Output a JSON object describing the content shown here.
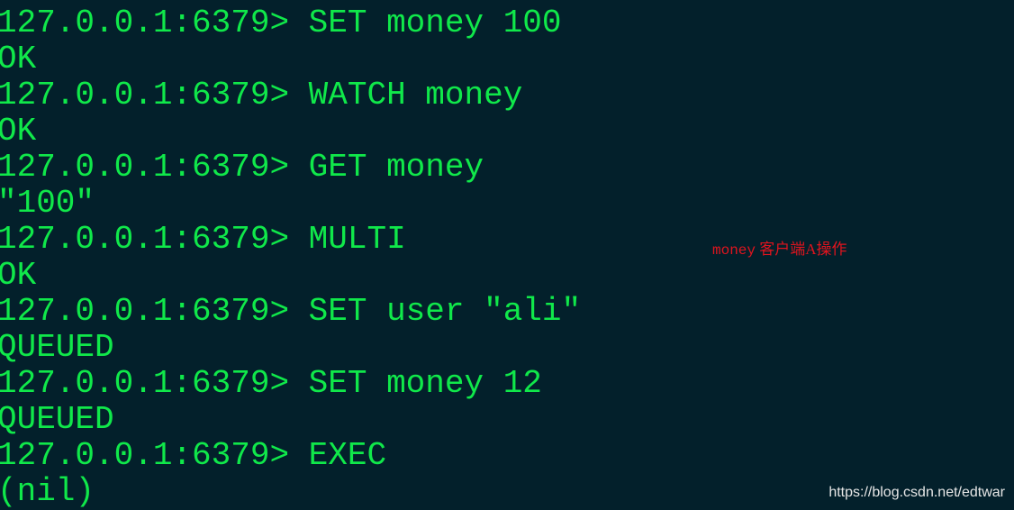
{
  "terminal": {
    "lines": [
      "127.0.0.1:6379> SET money 100",
      "OK",
      "127.0.0.1:6379> WATCH money",
      "OK",
      "127.0.0.1:6379> GET money",
      "\"100\"",
      "127.0.0.1:6379> MULTI",
      "OK",
      "127.0.0.1:6379> SET user \"ali\"",
      "QUEUED",
      "127.0.0.1:6379> SET money 12",
      "QUEUED",
      "127.0.0.1:6379> EXEC",
      "(nil)"
    ]
  },
  "annotation": {
    "word": "money",
    "text": " 客户端A操作"
  },
  "watermark": "https://blog.csdn.net/edtwar",
  "colors": {
    "background": "#03202b",
    "text": "#10e84a",
    "annotation": "#e0141e"
  }
}
